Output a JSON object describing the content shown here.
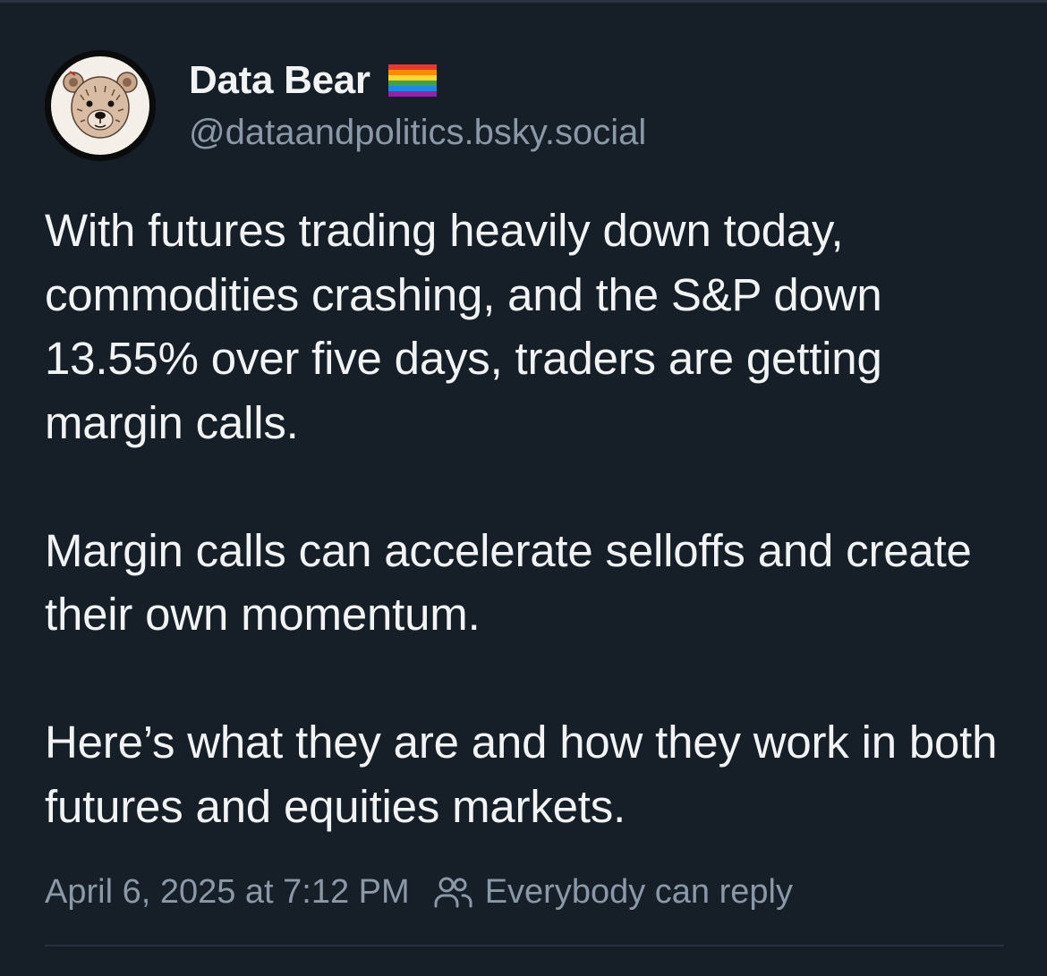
{
  "author": {
    "display_name": "Data Bear",
    "handle": "@dataandpolitics.bsky.social",
    "flag_icon": "rainbow-flag-icon",
    "avatar_icon": "bear-avatar"
  },
  "post": {
    "paragraphs": [
      "With futures trading heavily down today, commodities crashing, and the S&P down 13.55% over five days, traders are getting margin calls.",
      "Margin calls can accelerate selloffs and create their own momentum.",
      "Here’s what they are and how they work in both futures and equities markets."
    ],
    "timestamp": "April 6, 2025 at 7:12 PM",
    "reply_setting": "Everybody can reply",
    "reply_icon": "people-icon"
  },
  "colors": {
    "background": "#161e27",
    "text": "#f1f3f5",
    "muted": "#8b98a8",
    "divider": "#27303c"
  }
}
